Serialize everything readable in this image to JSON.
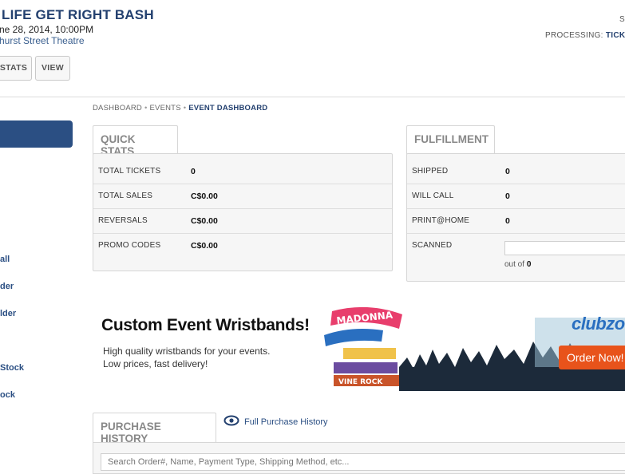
{
  "event": {
    "title": "LIFE GET RIGHT BASH",
    "date": "ne 28, 2014, 10:00PM",
    "venue": "hurst Street Theatre"
  },
  "header_right": {
    "s_label": "S",
    "processing_label": "PROCESSING:",
    "processing_value": "TICK"
  },
  "toolbar": {
    "stats_label": "STATS",
    "view_label": "VIEW"
  },
  "sidebar": {
    "items": [
      "all",
      "der",
      "lder",
      "Stock",
      "ock"
    ]
  },
  "breadcrumb": {
    "dashboard": "DASHBOARD",
    "events": "EVENTS",
    "current": "EVENT DASHBOARD"
  },
  "quick_stats": {
    "tab": "QUICK STATS",
    "rows": [
      {
        "label": "TOTAL TICKETS",
        "value": "0"
      },
      {
        "label": "TOTAL SALES",
        "value": "C$0.00"
      },
      {
        "label": "REVERSALS",
        "value": "C$0.00"
      },
      {
        "label": "PROMO CODES",
        "value": "C$0.00"
      }
    ]
  },
  "fulfillment": {
    "tab": "FULFILLMENT",
    "rows": [
      {
        "label": "SHIPPED",
        "value": "0"
      },
      {
        "label": "WILL CALL",
        "value": "0"
      },
      {
        "label": "PRINT@HOME",
        "value": "0"
      }
    ],
    "scanned_label": "SCANNED",
    "out_of_label": "out of",
    "out_of_value": "0"
  },
  "ad": {
    "headline": "Custom Event Wristbands!",
    "sub1": "High quality wristbands for your events.",
    "sub2": "Low prices, fast delivery!",
    "logo": "clubzon",
    "order_button": "Order Now!",
    "band_texts": [
      "MADONNA",
      "VINE ROCK"
    ]
  },
  "purchase_history": {
    "tab": "PURCHASE HISTORY",
    "full_link": "Full Purchase History",
    "search_placeholder": "Search Order#, Name, Payment Type, Shipping Method, etc..."
  },
  "colors": {
    "brand": "#23406f",
    "accent_blue": "#2b4f83",
    "order_orange": "#e8531b"
  }
}
